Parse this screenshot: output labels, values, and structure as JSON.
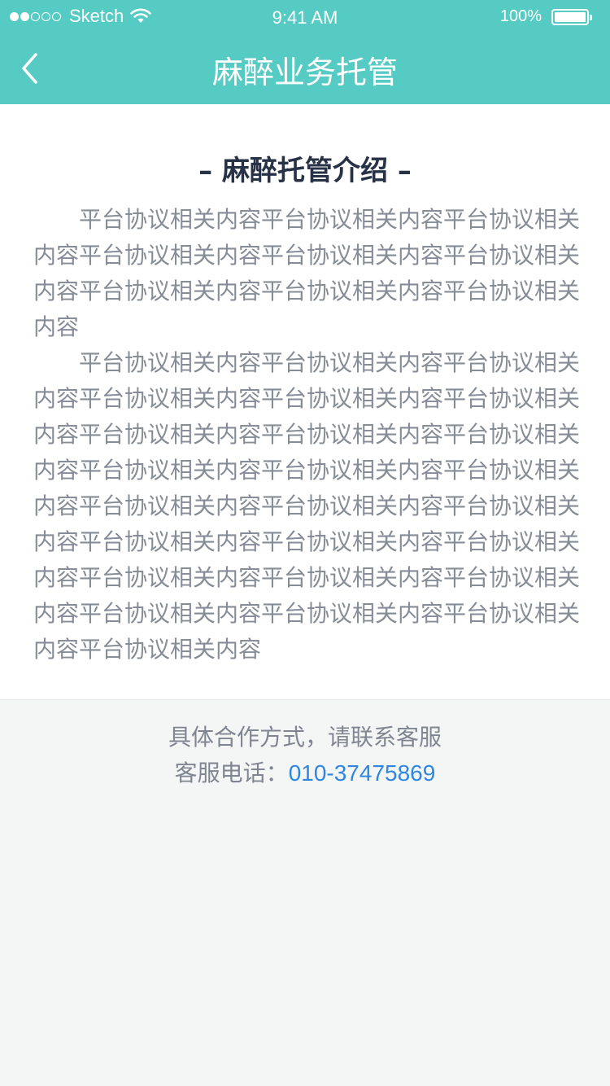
{
  "status_bar": {
    "carrier": "Sketch",
    "time": "9:41 AM",
    "battery": "100%"
  },
  "nav": {
    "title": "麻醉业务托管",
    "back_icon": "chevron-left-icon"
  },
  "intro": {
    "title": "– 麻醉托管介绍 –",
    "paragraphs": [
      "平台协议相关内容平台协议相关内容平台协议相关内容平台协议相关内容平台协议相关内容平台协议相关内容平台协议相关内容平台协议相关内容平台协议相关内容",
      "平台协议相关内容平台协议相关内容平台协议相关内容平台协议相关内容平台协议相关内容平台协议相关内容平台协议相关内容平台协议相关内容平台协议相关内容平台协议相关内容平台协议相关内容平台协议相关内容平台协议相关内容平台协议相关内容平台协议相关内容平台协议相关内容平台协议相关内容平台协议相关内容平台协议相关内容平台协议相关内容平台协议相关内容平台协议相关内容平台协议相关内容平台协议相关内容平台协议相关内容"
    ]
  },
  "contact": {
    "line1": "具体合作方式，请联系客服",
    "phone_label": "客服电话：",
    "phone_number": "010-37475869"
  },
  "colors": {
    "accent": "#55cbc4",
    "title_text": "#283246",
    "body_text": "#868d97",
    "link": "#2d87e0",
    "page_bg": "#f4f5f5"
  }
}
